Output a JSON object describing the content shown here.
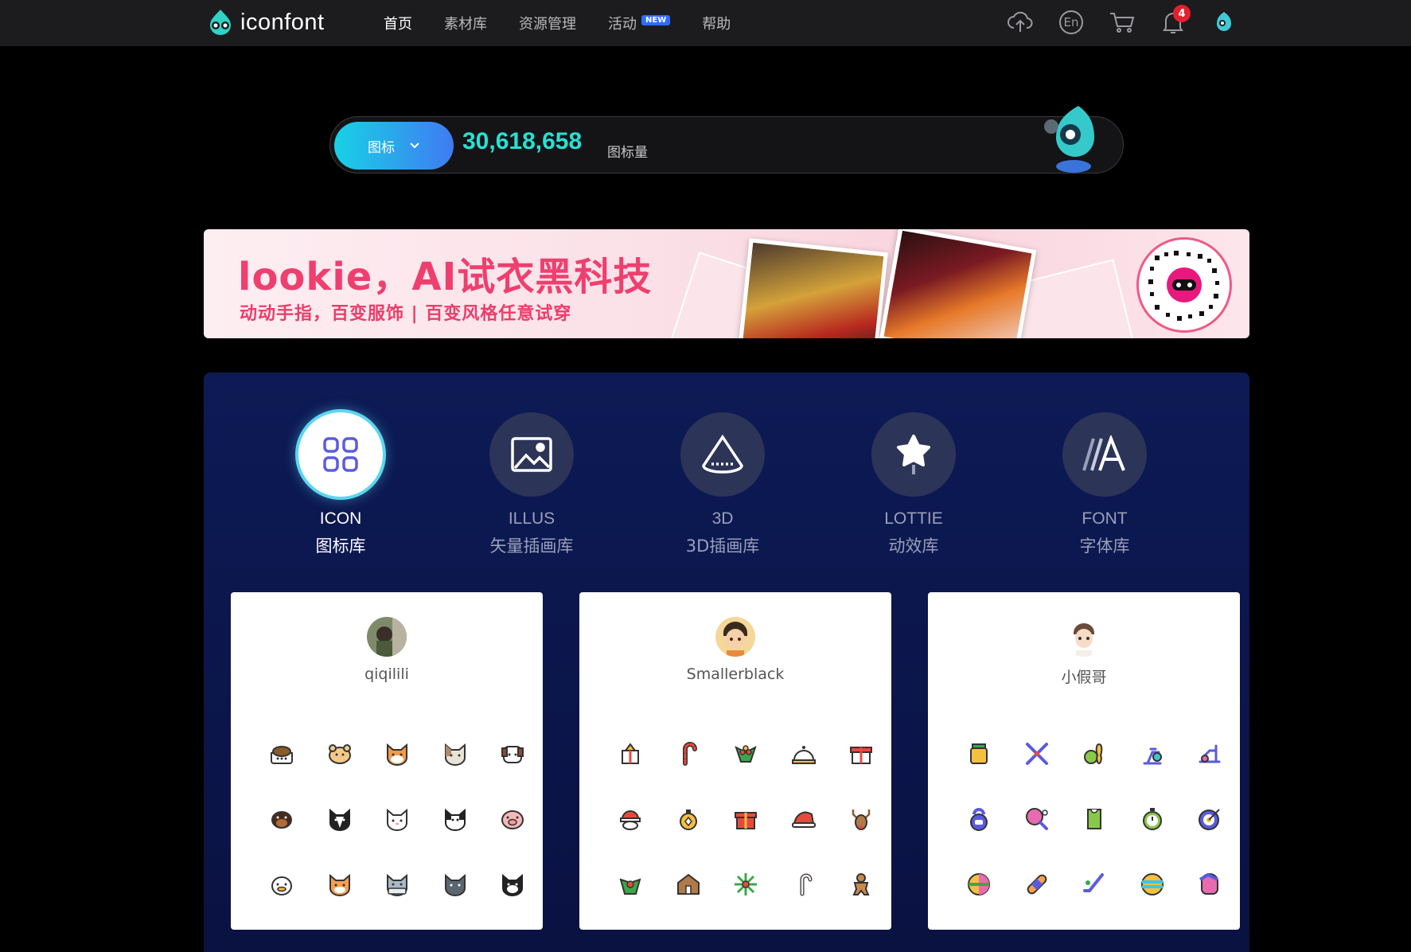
{
  "nav": {
    "logo_text": "iconfont",
    "items": [
      {
        "label": "首页",
        "active": true
      },
      {
        "label": "素材库",
        "active": false
      },
      {
        "label": "资源管理",
        "active": false
      },
      {
        "label": "活动",
        "active": false,
        "badge": "NEW"
      },
      {
        "label": "帮助",
        "active": false
      }
    ],
    "right_icons": [
      "upload-icon",
      "language-icon",
      "cart-icon",
      "bell-icon",
      "user-avatar"
    ],
    "language_label": "En",
    "notification_count": "4"
  },
  "search": {
    "type_label": "图标",
    "count": "30,618,658",
    "unit": "图标量"
  },
  "banner": {
    "title": "lookie，AI试衣黑科技",
    "subtitle": "动动手指，百变服饰 | 百变风格任意试穿"
  },
  "categories": [
    {
      "en": "ICON",
      "cn": "图标库",
      "icon": "grid-icon",
      "active": true
    },
    {
      "en": "ILLUS",
      "cn": "矢量插画库",
      "icon": "image-icon",
      "active": false
    },
    {
      "en": "3D",
      "cn": "3D插画库",
      "icon": "cone-icon",
      "active": false
    },
    {
      "en": "LOTTIE",
      "cn": "动效库",
      "icon": "lottie-icon",
      "active": false
    },
    {
      "en": "FONT",
      "cn": "字体库",
      "icon": "font-icon",
      "active": false
    }
  ],
  "icon_sets": [
    {
      "author": "qiqilili",
      "icons": [
        "dog-bowl-icon",
        "hamster-icon",
        "shiba-icon",
        "cat-icon",
        "puppy-icon",
        "rottweiler-icon",
        "husky-icon",
        "white-cat-icon",
        "black-white-dog-icon",
        "pig-icon",
        "duck-icon",
        "orange-cat-icon",
        "gray-cat-icon",
        "dark-cat-icon",
        "tuxedo-cat-icon"
      ]
    },
    {
      "author": "Smallerblack",
      "icons": [
        "present-icon",
        "candy-cane-icon",
        "holly-icon",
        "bell-icon",
        "gift-box-icon",
        "santa-icon",
        "ornament-icon",
        "gift-icon",
        "santa-hat-icon",
        "reindeer-icon",
        "wreath-icon",
        "gingerbread-house-icon",
        "snowflake-icon",
        "candy-cane-icon",
        "gingerbread-man-icon"
      ]
    },
    {
      "author": "小假哥",
      "icons": [
        "protein-jar-icon",
        "crossed-bats-icon",
        "bowling-icon",
        "exercise-bike-icon",
        "elliptical-icon",
        "kettlebell-icon",
        "ping-pong-icon",
        "jersey-icon",
        "stopwatch-icon",
        "target-icon",
        "volleyball-icon",
        "bandage-icon",
        "hockey-stick-icon",
        "beach-ball-icon",
        "boxing-glove-icon"
      ]
    }
  ],
  "colors": {
    "accent_cyan": "#28e0d4",
    "nav_bg": "#1c1c1e",
    "panel_bg": "#0d1a55",
    "banner_pink": "#ef3f6f",
    "notif_red": "#e5202e"
  }
}
